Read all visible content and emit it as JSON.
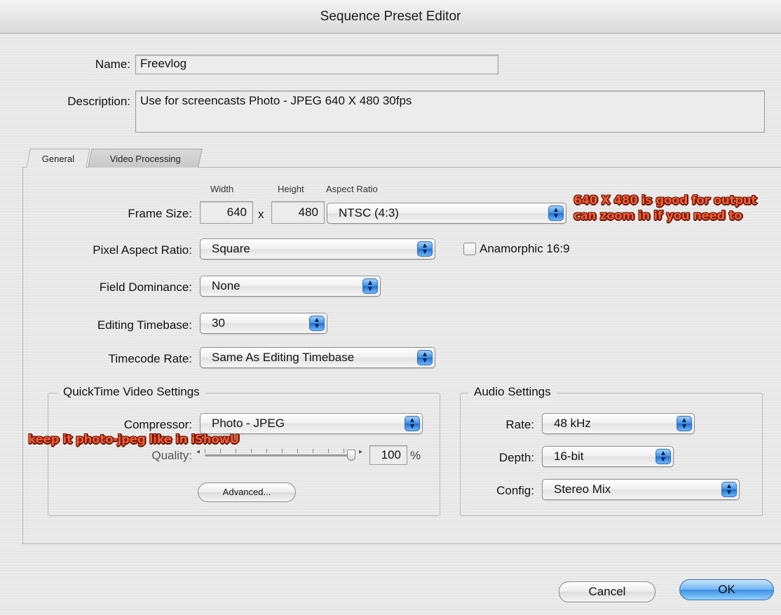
{
  "window": {
    "title": "Sequence Preset Editor"
  },
  "name": {
    "label": "Name:",
    "value": "Freevlog"
  },
  "description": {
    "label": "Description:",
    "value": "Use for screencasts Photo - JPEG 640 X 480 30fps"
  },
  "tabs": [
    {
      "label": "General",
      "active": true
    },
    {
      "label": "Video Processing",
      "active": false
    }
  ],
  "frame_size": {
    "label": "Frame Size:",
    "width_header": "Width",
    "height_header": "Height",
    "aspect_header": "Aspect Ratio",
    "width": "640",
    "times": "x",
    "height": "480",
    "aspect_value": "NTSC (4:3)"
  },
  "pixel_aspect": {
    "label": "Pixel Aspect Ratio:",
    "value": "Square",
    "checkbox_label": "Anamorphic 16:9",
    "checked": false
  },
  "field_dominance": {
    "label": "Field Dominance:",
    "value": "None"
  },
  "editing_timebase": {
    "label": "Editing Timebase:",
    "value": "30"
  },
  "timecode_rate": {
    "label": "Timecode Rate:",
    "value": "Same As Editing Timebase"
  },
  "quicktime": {
    "title": "QuickTime Video Settings",
    "compressor_label": "Compressor:",
    "compressor_value": "Photo - JPEG",
    "quality_label": "Quality:",
    "quality_value": "100",
    "quality_unit": "%",
    "quality_level": 1.0,
    "advanced_label": "Advanced..."
  },
  "audio": {
    "title": "Audio Settings",
    "rate_label": "Rate:",
    "rate_value": "48 kHz",
    "depth_label": "Depth:",
    "depth_value": "16-bit",
    "config_label": "Config:",
    "config_value": "Stereo Mix"
  },
  "annotations": {
    "frame_line1": "640 X 480 is good for output",
    "frame_line2": "can zoom in if you need to",
    "compressor": "keep it photo-jpeg like in iShowU"
  },
  "buttons": {
    "cancel": "Cancel",
    "ok": "OK"
  },
  "colors": {
    "accent": "#3c8fe6",
    "annotation": "#ff5a2a"
  }
}
